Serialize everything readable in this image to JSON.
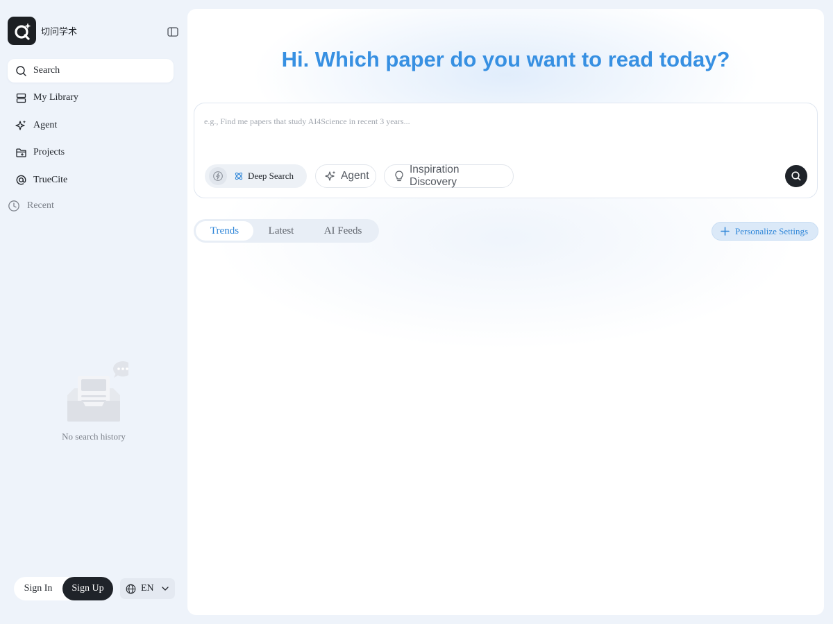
{
  "app": {
    "brand_name": "切问学术",
    "logo_icon": "logo-q-icon"
  },
  "sidebar": {
    "items": [
      {
        "label": "Search",
        "icon": "search-icon",
        "active": true
      },
      {
        "label": "My Library",
        "icon": "library-icon",
        "active": false
      },
      {
        "label": "Agent",
        "icon": "sparkle-icon",
        "active": false
      },
      {
        "label": "Projects",
        "icon": "folder-plus-icon",
        "active": false
      },
      {
        "label": "TrueCite",
        "icon": "at-icon",
        "active": false
      }
    ],
    "recent_label": "Recent",
    "empty_text": "No search history",
    "sign_in": "Sign In",
    "sign_up": "Sign Up",
    "language": "EN"
  },
  "main": {
    "headline": "Hi. Which paper do you want to read today?",
    "search": {
      "placeholder": "e.g., Find me papers that study AI4Science in recent 3 years...",
      "value": ""
    },
    "modes": {
      "deep_search": "Deep Search",
      "agent": "Agent",
      "inspiration": "Inspiration Discovery"
    },
    "tabs": [
      {
        "label": "Trends",
        "active": true
      },
      {
        "label": "Latest",
        "active": false
      },
      {
        "label": "AI Feeds",
        "active": false
      }
    ],
    "personalize_label": "Personalize Settings"
  },
  "colors": {
    "accent": "#3790e2",
    "dark": "#1f2329",
    "sidebar_bg": "#eef3fa"
  }
}
